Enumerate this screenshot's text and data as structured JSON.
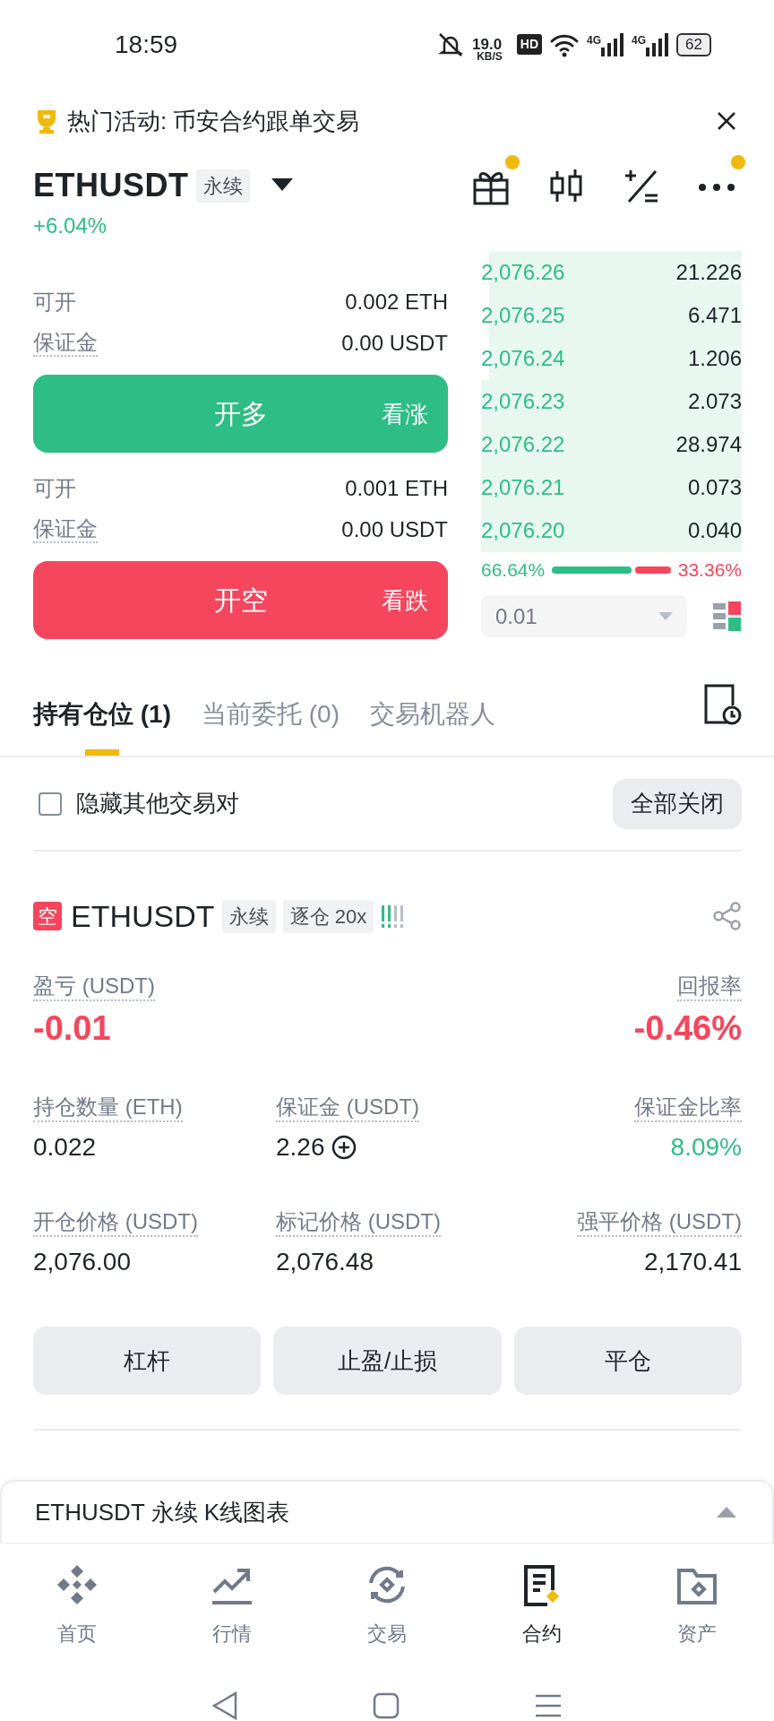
{
  "status_bar": {
    "time": "18:59",
    "speed": "19.0",
    "speed_unit": "KB/S",
    "hd": "HD",
    "networks": [
      "4G",
      "4G"
    ],
    "battery": "62"
  },
  "banner": {
    "text": "热门活动: 币安合约跟单交易"
  },
  "header": {
    "symbol": "ETHUSDT",
    "tag": "永续",
    "change": "+6.04%",
    "actions": [
      {
        "kind": "gift",
        "dot": true
      },
      {
        "kind": "candles",
        "dot": false
      },
      {
        "kind": "calculator",
        "dot": false
      },
      {
        "kind": "more",
        "dot": true
      }
    ]
  },
  "order_panel": {
    "sides": [
      {
        "kind": "long",
        "available_label": "可开",
        "available": "0.002 ETH",
        "margin_label": "保证金",
        "margin": "0.00 USDT",
        "button": "开多",
        "hint": "看涨"
      },
      {
        "kind": "short",
        "available_label": "可开",
        "available": "0.001 ETH",
        "margin_label": "保证金",
        "margin": "0.00 USDT",
        "button": "开空",
        "hint": "看跌"
      }
    ],
    "order_book": {
      "rows": [
        {
          "price": "2,076.26",
          "qty": "21.226"
        },
        {
          "price": "2,076.25",
          "qty": "6.471"
        },
        {
          "price": "2,076.24",
          "qty": "1.206"
        },
        {
          "price": "2,076.23",
          "qty": "2.073"
        },
        {
          "price": "2,076.22",
          "qty": "28.974"
        },
        {
          "price": "2,076.21",
          "qty": "0.073"
        },
        {
          "price": "2,076.20",
          "qty": "0.040"
        }
      ],
      "buy_share": "66.64%",
      "sell_share": "33.36%",
      "level": 0.6664,
      "precision": "0.01"
    }
  },
  "tabs": [
    {
      "label": "持有仓位 (1)",
      "selected": true
    },
    {
      "label": "当前委托 (0)",
      "selected": false
    },
    {
      "label": "交易机器人",
      "selected": false
    }
  ],
  "filter": {
    "label": "隐藏其他交易对",
    "checked": false,
    "close_all": "全部关闭"
  },
  "position": {
    "side": "空",
    "kind": "short",
    "symbol": "ETHUSDT",
    "tags": [
      "永续",
      "逐仓 20x"
    ],
    "risk": {
      "level": 0.5
    },
    "rows": [
      {
        "left": {
          "label": "盈亏 (USDT)",
          "value": "-0.01",
          "color": "#f6465d",
          "large": true
        },
        "right": {
          "label": "回报率",
          "value": "-0.46%",
          "color": "#f6465d",
          "large": true
        }
      },
      {
        "left": {
          "label": "持仓数量 (ETH)",
          "value": "0.022",
          "color": "#1e2329",
          "large": false
        },
        "middle": {
          "label": "保证金 (USDT)",
          "value": "2.26",
          "color": "#1e2329",
          "large": false,
          "addable": true
        },
        "right": {
          "label": "保证金比率",
          "value": "8.09%",
          "color": "#2ebd85",
          "large": false
        }
      },
      {
        "left": {
          "label": "开仓价格 (USDT)",
          "value": "2,076.00",
          "color": "#1e2329",
          "large": false
        },
        "middle": {
          "label": "标记价格 (USDT)",
          "value": "2,076.48",
          "color": "#1e2329",
          "large": false
        },
        "right": {
          "label": "强平价格 (USDT)",
          "value": "2,170.41",
          "color": "#1e2329",
          "large": false
        }
      }
    ],
    "buttons": [
      "杠杆",
      "止盈/止损",
      "平仓"
    ]
  },
  "chart_panel": {
    "title": "ETHUSDT 永续 K线图表"
  },
  "bottom_nav": [
    {
      "kind": "home",
      "label": "首页",
      "selected": false
    },
    {
      "kind": "markets",
      "label": "行情",
      "selected": false
    },
    {
      "kind": "trade",
      "label": "交易",
      "selected": false
    },
    {
      "kind": "futures",
      "label": "合约",
      "selected": true
    },
    {
      "kind": "assets",
      "label": "资产",
      "selected": false
    }
  ]
}
